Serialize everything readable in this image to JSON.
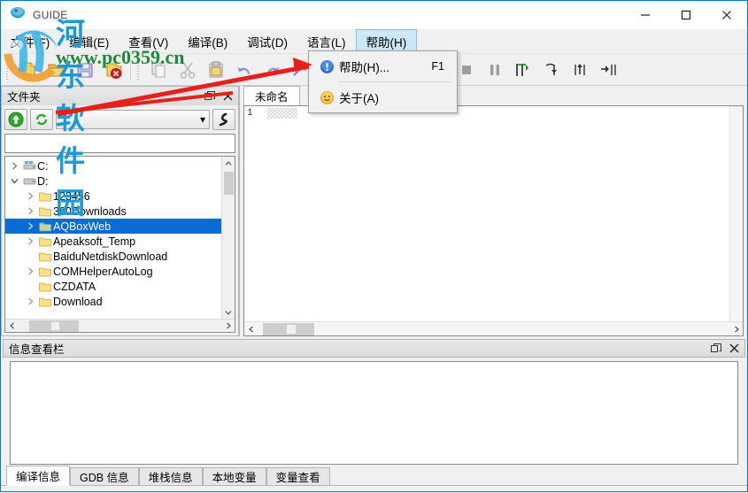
{
  "window": {
    "title": "GUIDE",
    "icon": "app-icon",
    "controls": {
      "minimize": "─",
      "maximize": "□",
      "close": "✕"
    }
  },
  "menubar": {
    "items": [
      {
        "label": "文件(F)",
        "active": false
      },
      {
        "label": "编辑(E)",
        "active": false
      },
      {
        "label": "查看(V)",
        "active": false
      },
      {
        "label": "编译(B)",
        "active": false
      },
      {
        "label": "调试(D)",
        "active": false
      },
      {
        "label": "语言(L)",
        "active": false
      },
      {
        "label": "帮助(H)",
        "active": true
      }
    ]
  },
  "help_menu": {
    "items": [
      {
        "label": "帮助(H)...",
        "shortcut": "F1",
        "icon": "info-icon"
      },
      {
        "label": "关于(A)",
        "shortcut": "",
        "icon": "smiley-icon"
      }
    ]
  },
  "toolbar": {
    "groups": [
      {
        "buttons": [
          {
            "name": "new-file-button",
            "icon": "new-file-icon"
          },
          {
            "name": "open-folder-button",
            "icon": "open-folder-icon"
          },
          {
            "name": "save-button",
            "icon": "save-icon"
          },
          {
            "name": "close-file-button",
            "icon": "close-file-icon"
          }
        ]
      },
      {
        "buttons": [
          {
            "name": "copy-button",
            "icon": "copy-icon"
          },
          {
            "name": "cut-button",
            "icon": "scissors-icon"
          },
          {
            "name": "paste-button",
            "icon": "paste-icon"
          },
          {
            "name": "undo-button",
            "icon": "undo-icon"
          },
          {
            "name": "redo-button",
            "icon": "redo-icon"
          },
          {
            "name": "tools-button",
            "icon": "tools-icon"
          }
        ]
      },
      {
        "buttons": [
          {
            "name": "compile-button",
            "icon": "compile-icon"
          },
          {
            "name": "build-run-button",
            "icon": "build-run-icon"
          },
          {
            "name": "run-button",
            "icon": "run-icon"
          },
          {
            "name": "debug-button",
            "icon": "debug-icon"
          }
        ]
      },
      {
        "buttons": [
          {
            "name": "stop-button",
            "icon": "stop-icon"
          },
          {
            "name": "pause-button",
            "icon": "pause-icon"
          },
          {
            "name": "step-over-button",
            "icon": "step-over-icon"
          },
          {
            "name": "step-into-button",
            "icon": "step-into-icon"
          },
          {
            "name": "step-out-button",
            "icon": "step-out-icon"
          },
          {
            "name": "run-to-cursor-button",
            "icon": "run-to-cursor-icon"
          }
        ]
      }
    ]
  },
  "folder_dock": {
    "title": "文件夹",
    "float_icon": "float-icon",
    "close_icon": "close-icon",
    "up_button_icon": "up-arrow-icon",
    "refresh_button_icon": "refresh-icon",
    "combo_value": "",
    "combo_arrow": "▾",
    "filter_button_icon": "filter-icon",
    "path_value": "",
    "tree": [
      {
        "label": "C:",
        "depth": 0,
        "icon": "drive-icon",
        "expander": "collapsed",
        "selected": false
      },
      {
        "label": "D:",
        "depth": 0,
        "icon": "drive-icon",
        "expander": "expanded",
        "selected": false
      },
      {
        "label": "123456",
        "depth": 1,
        "icon": "folder-icon",
        "expander": "collapsed",
        "selected": false
      },
      {
        "label": "360Downloads",
        "depth": 1,
        "icon": "folder-icon",
        "expander": "collapsed",
        "selected": false
      },
      {
        "label": "AQBoxWeb",
        "depth": 1,
        "icon": "folder-icon",
        "expander": "collapsed",
        "selected": true
      },
      {
        "label": "Apeaksoft_Temp",
        "depth": 1,
        "icon": "folder-icon",
        "expander": "collapsed",
        "selected": false
      },
      {
        "label": "BaiduNetdiskDownload",
        "depth": 1,
        "icon": "folder-icon",
        "expander": "none",
        "selected": false
      },
      {
        "label": "COMHelperAutoLog",
        "depth": 1,
        "icon": "folder-icon",
        "expander": "collapsed",
        "selected": false
      },
      {
        "label": "CZDATA",
        "depth": 1,
        "icon": "folder-icon",
        "expander": "none",
        "selected": false
      },
      {
        "label": "Download",
        "depth": 1,
        "icon": "folder-icon",
        "expander": "collapsed",
        "selected": false
      }
    ]
  },
  "editor": {
    "tabs": [
      {
        "label": "未命名",
        "active": true
      }
    ],
    "line_numbers": [
      "1"
    ],
    "content": ""
  },
  "info_dock": {
    "title": "信息查看栏",
    "float_icon": "float-icon",
    "close_icon": "close-icon",
    "content": "",
    "tabs": [
      {
        "label": "编译信息",
        "active": true
      },
      {
        "label": "GDB 信息",
        "active": false
      },
      {
        "label": "堆栈信息",
        "active": false
      },
      {
        "label": "本地变量",
        "active": false
      },
      {
        "label": "变量查看",
        "active": false
      }
    ]
  },
  "watermark": {
    "text": "河东软件园",
    "url": "www.pc0359.cn",
    "logo": "pc0359-logo"
  },
  "annotation": {
    "arrow_color": "#e8201b",
    "arrow_label": "pointer-to-help-menu-item"
  },
  "colors": {
    "window_border": "#0078d7",
    "menu_active_bg": "#cce8f7",
    "tree_selection": "#0a6cd4",
    "watermark_blue": "#1b9ad6",
    "watermark_green": "#1a8b3a",
    "annotation_red": "#e8201b"
  }
}
